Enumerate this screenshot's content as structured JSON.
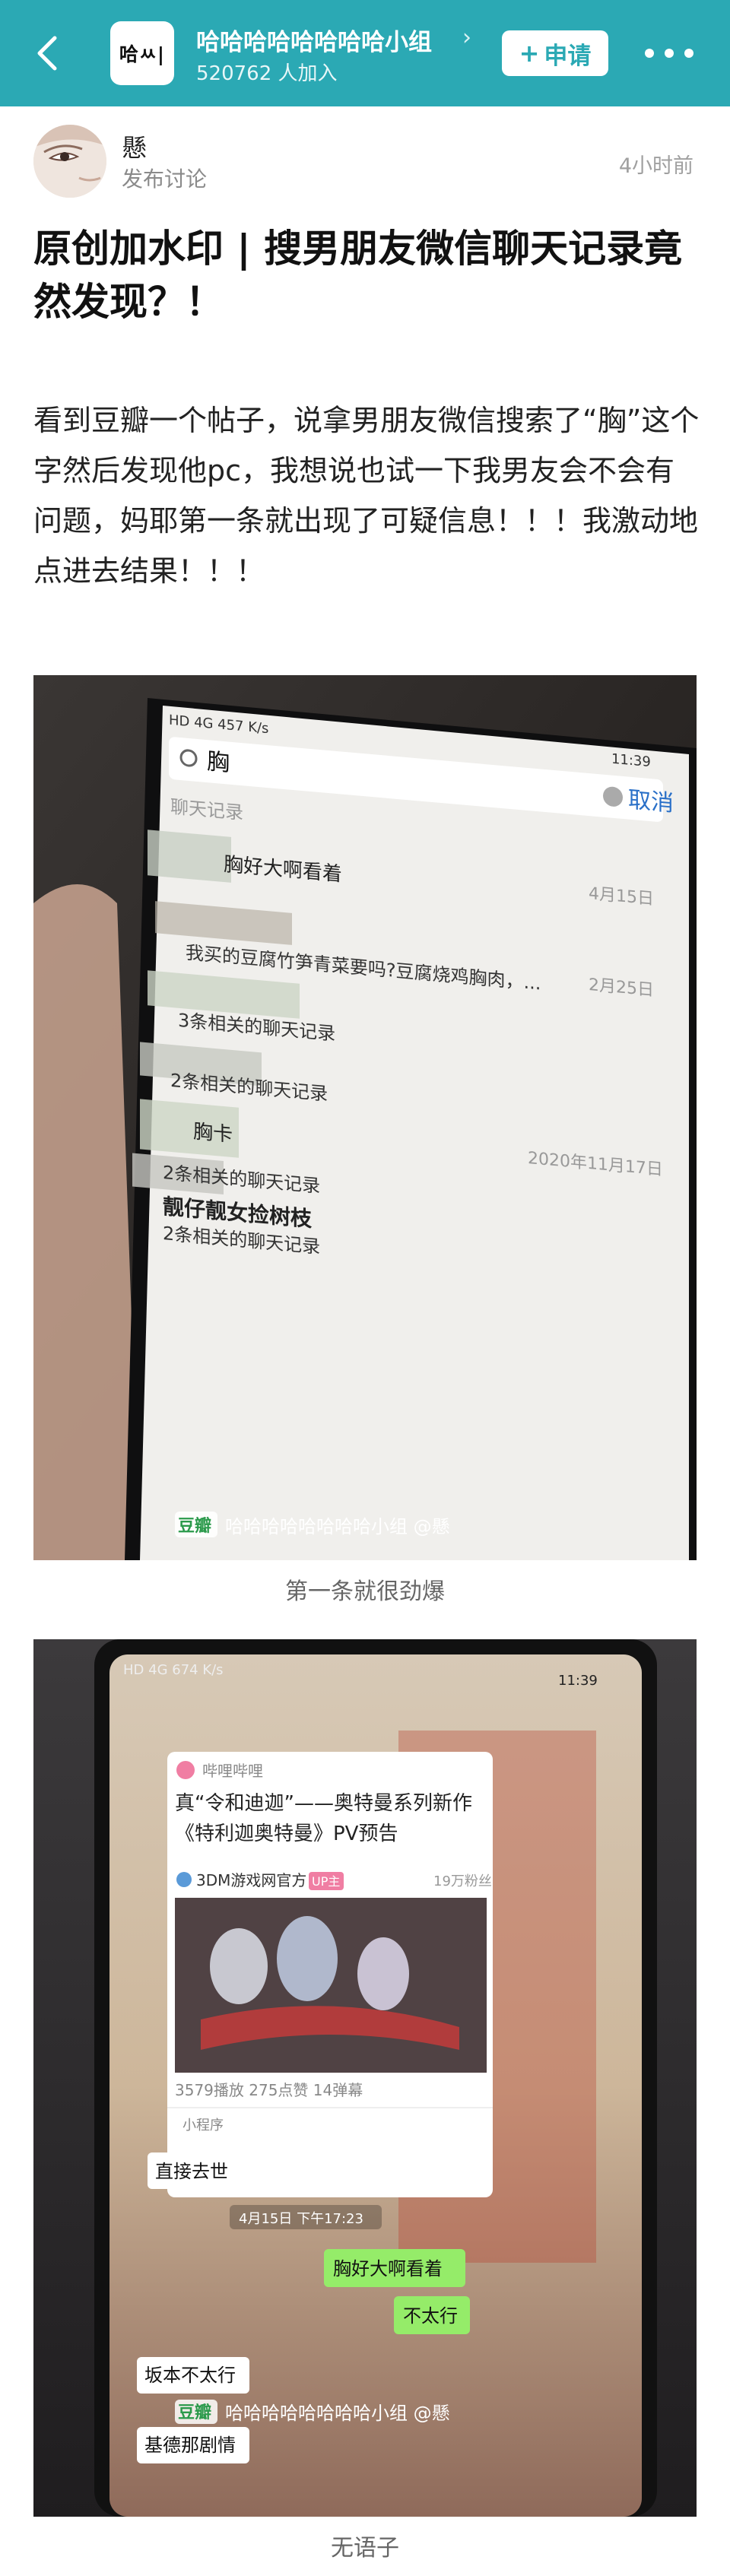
{
  "header": {
    "back_icon": "chevron-left-icon",
    "group_logo_text": "哈ㅆ|",
    "group_title": "哈哈哈哈哈哈哈哈小组",
    "group_members": "520762 人加入",
    "apply_label": "申请",
    "apply_icon": "plus-icon",
    "more_icon": "more-dots-icon",
    "brand_color": "#2ba9b4"
  },
  "author": {
    "name": "懸",
    "post_type": "发布讨论",
    "time": "4小时前"
  },
  "post": {
    "title": "原创加水印 | 搜男朋友微信聊天记录竟然发现？！",
    "body": "看到豆瓣一个帖子，说拿男朋友微信搜索了“胸”这个字然后发现他pc，我想说也试一下我男友会不会有问题，妈耶第一条就出现了可疑信息！！！我激动地点进去结果！！！"
  },
  "image1": {
    "status_left": "HD 4G 457 K/s",
    "status_right": "11:39",
    "search_query": "胸",
    "cancel_label": "取消",
    "section_label": "聊天记录",
    "results": [
      {
        "text": "胸好大啊看着",
        "date": "4月15日"
      },
      {
        "text": "我买的豆腐竹笋青菜要吗?豆腐烧鸡胸肉，...",
        "date": "2月25日"
      },
      {
        "text": "3条相关的聊天记录",
        "date": ""
      },
      {
        "text": "2条相关的聊天记录",
        "date": ""
      },
      {
        "text": "胸卡",
        "date": "2020年11月17日"
      },
      {
        "text": "2条相关的聊天记录",
        "date": ""
      },
      {
        "text": "靓仔靓女捡树枝",
        "date": ""
      },
      {
        "text": "2条相关的聊天记录",
        "date": ""
      }
    ],
    "watermark_logo": "豆瓣",
    "watermark": "哈哈哈哈哈哈哈哈小组 @懸",
    "caption": "第一条就很劲爆"
  },
  "image2": {
    "status_left": "HD 4G 674 K/s",
    "status_right": "11:39",
    "card_source": "哔哩哔哩",
    "card_title": "真“令和迪迦”——奥特曼系列新作《特利迦奥特曼》PV预告",
    "card_uploader": "3DM游戏网官方",
    "card_uploader_badge": "UP主",
    "card_fans": "19万粉丝",
    "card_stats": "3579播放  275点赞  14弹幕",
    "card_footer": "小程序",
    "messages": [
      {
        "text": "直接去世",
        "side": "left"
      },
      {
        "text": "4月15日 下午17:23",
        "side": "center"
      },
      {
        "text": "胸好大啊看着",
        "side": "right"
      },
      {
        "text": "不太行",
        "side": "right"
      },
      {
        "text": "坂本不太行",
        "side": "left"
      },
      {
        "text": "基德那剧情",
        "side": "left"
      }
    ],
    "watermark_logo": "豆瓣",
    "watermark": "哈哈哈哈哈哈哈哈小组 @懸",
    "caption": "无语子"
  }
}
